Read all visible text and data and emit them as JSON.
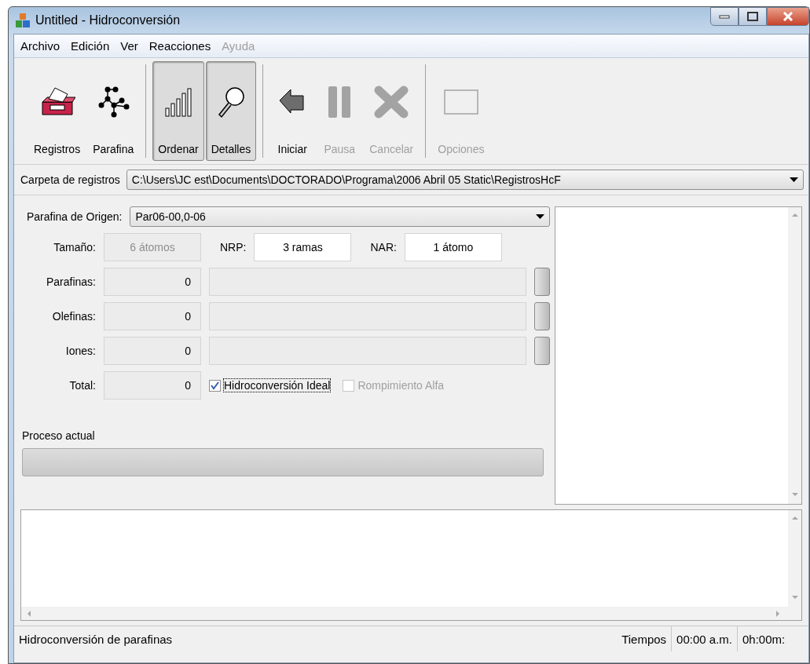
{
  "window": {
    "title": "Untitled - Hidroconversión"
  },
  "menu": [
    {
      "label": "Archivo",
      "disabled": false
    },
    {
      "label": "Edición",
      "disabled": false
    },
    {
      "label": "Ver",
      "disabled": false
    },
    {
      "label": "Reacciones",
      "disabled": false
    },
    {
      "label": "Ayuda",
      "disabled": true
    }
  ],
  "toolbar": [
    {
      "label": "Registros",
      "pressed": false,
      "disabled": false,
      "separator_before": false
    },
    {
      "label": "Parafina",
      "pressed": false,
      "disabled": false,
      "separator_before": false
    },
    {
      "label": "Ordenar",
      "pressed": true,
      "disabled": false,
      "separator_before": true
    },
    {
      "label": "Detalles",
      "pressed": true,
      "disabled": false,
      "separator_before": false
    },
    {
      "label": "Iniciar",
      "pressed": false,
      "disabled": false,
      "separator_before": true
    },
    {
      "label": "Pausa",
      "pressed": false,
      "disabled": true,
      "separator_before": false
    },
    {
      "label": "Cancelar",
      "pressed": false,
      "disabled": true,
      "separator_before": false
    },
    {
      "label": "Opciones",
      "pressed": false,
      "disabled": true,
      "separator_before": true
    }
  ],
  "folder": {
    "label": "Carpeta de registros",
    "value": "C:\\Users\\JC est\\Documents\\DOCTORADO\\Programa\\2006 Abril 05 Static\\RegistrosHcF"
  },
  "origin": {
    "label": "Parafina de Origen:",
    "value": "Par06-00,0-06"
  },
  "size_row": [
    {
      "label": "Tamaño:",
      "value": "6 átomos",
      "disabled": true
    },
    {
      "label": "NRP:",
      "value": "3 ramas",
      "disabled": false
    },
    {
      "label": "NAR:",
      "value": "1 átomo",
      "disabled": false
    }
  ],
  "counters": [
    {
      "label": "Parafinas:",
      "value": "0",
      "level": 0
    },
    {
      "label": "Olefinas:",
      "value": "0",
      "level": 0
    },
    {
      "label": "Iones:",
      "value": "0",
      "level": 0
    }
  ],
  "total": {
    "label": "Total:",
    "value": "0"
  },
  "options": [
    {
      "label": "Hidroconversión Ideal",
      "checked": true,
      "disabled": false,
      "focused": true
    },
    {
      "label": "Rompimiento Alfa",
      "checked": false,
      "disabled": true,
      "focused": false
    }
  ],
  "process": {
    "label": "Proceso actual",
    "level": 0
  },
  "status_bar": {
    "message": "Hidroconversión de parafinas",
    "times_label": "Tiempos",
    "clock": "00:00 a.m.",
    "elapsed": "0h:00m:"
  }
}
